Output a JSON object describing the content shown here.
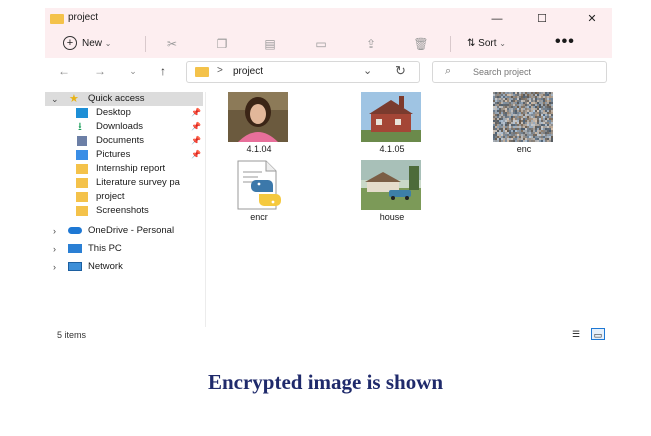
{
  "window": {
    "title": "project",
    "controls": {
      "minimize": "—",
      "maximize": "☐",
      "close": "✕"
    }
  },
  "toolbar": {
    "new_label": "New",
    "sort_label": "Sort",
    "more": "•••",
    "icons": [
      "cut-icon",
      "copy-icon",
      "paste-icon",
      "rename-icon",
      "share-icon",
      "delete-icon"
    ]
  },
  "address": {
    "path": "project",
    "separator": ">",
    "search_placeholder": "Search project"
  },
  "sidebar": {
    "quick_access": "Quick access",
    "items": [
      {
        "label": "Desktop",
        "pinned": true,
        "icon": "desktop-icon",
        "color": "#1e8fd6"
      },
      {
        "label": "Downloads",
        "pinned": true,
        "icon": "download-icon",
        "color": "#1a9e5a"
      },
      {
        "label": "Documents",
        "pinned": true,
        "icon": "documents-icon",
        "color": "#6c7fa6"
      },
      {
        "label": "Pictures",
        "pinned": true,
        "icon": "pictures-icon",
        "color": "#3a8ee6"
      },
      {
        "label": "Internship report",
        "pinned": false,
        "icon": "folder-icon",
        "color": "#f4c24a"
      },
      {
        "label": "Literature survey pa",
        "pinned": false,
        "icon": "folder-icon",
        "color": "#f4c24a"
      },
      {
        "label": "project",
        "pinned": false,
        "icon": "folder-icon",
        "color": "#f4c24a"
      },
      {
        "label": "Screenshots",
        "pinned": false,
        "icon": "folder-icon",
        "color": "#f4c24a"
      }
    ],
    "onedrive": "OneDrive - Personal",
    "this_pc": "This PC",
    "network": "Network"
  },
  "files": [
    {
      "name": "4.1.04",
      "type": "photo-portrait"
    },
    {
      "name": "4.1.05",
      "type": "photo-house"
    },
    {
      "name": "enc",
      "type": "noise"
    },
    {
      "name": "encr",
      "type": "python-file"
    },
    {
      "name": "house",
      "type": "photo-house2"
    }
  ],
  "status": {
    "items": "5 items"
  },
  "caption": "Encrypted image is shown",
  "colors": {
    "titlebar": "#fdeef0",
    "folder": "#f4c24a",
    "caption": "#1f2a6b"
  }
}
